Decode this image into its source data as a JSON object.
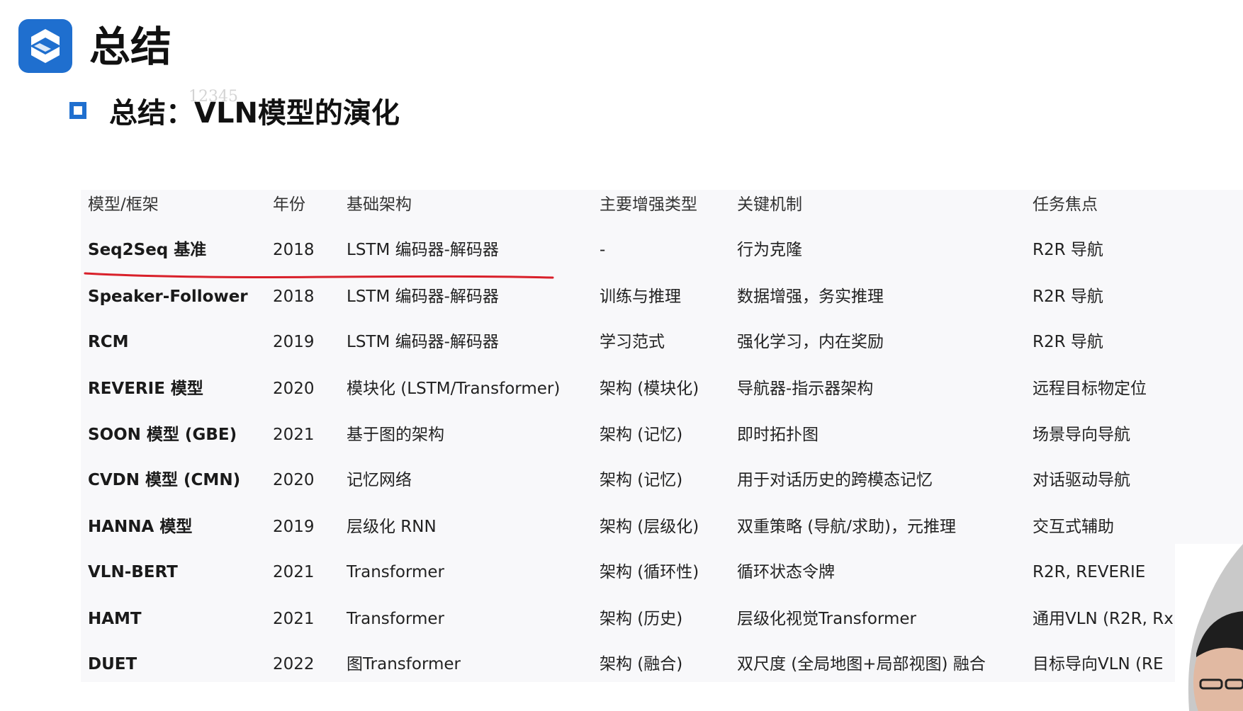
{
  "header": {
    "title": "总结"
  },
  "watermark": "12345",
  "section": {
    "title": "总结：VLN模型的演化"
  },
  "colors": {
    "accent": "#1f6fcf",
    "annotation": "#d9202a",
    "table_bg": "#f8f8fa"
  },
  "icons": {
    "logo": "s-logo-icon",
    "bullet": "square-outline-icon"
  },
  "table": {
    "headers": [
      "模型/框架",
      "年份",
      "基础架构",
      "主要增强类型",
      "关键机制",
      "任务焦点"
    ],
    "rows": [
      [
        "Seq2Seq 基准",
        "2018",
        "LSTM 编码器-解码器",
        "-",
        "行为克隆",
        "R2R 导航"
      ],
      [
        "Speaker-Follower",
        "2018",
        "LSTM 编码器-解码器",
        "训练与推理",
        "数据增强，务实推理",
        "R2R 导航"
      ],
      [
        "RCM",
        "2019",
        "LSTM 编码器-解码器",
        "学习范式",
        "强化学习，内在奖励",
        "R2R 导航"
      ],
      [
        "REVERIE 模型",
        "2020",
        "模块化 (LSTM/Transformer)",
        "架构 (模块化)",
        "导航器-指示器架构",
        "远程目标物定位"
      ],
      [
        "SOON 模型 (GBE)",
        "2021",
        "基于图的架构",
        "架构 (记忆)",
        "即时拓扑图",
        "场景导向导航"
      ],
      [
        "CVDN 模型 (CMN)",
        "2020",
        "记忆网络",
        "架构 (记忆)",
        "用于对话历史的跨模态记忆",
        "对话驱动导航"
      ],
      [
        "HANNA 模型",
        "2019",
        "层级化 RNN",
        "架构 (层级化)",
        "双重策略 (导航/求助)，元推理",
        "交互式辅助"
      ],
      [
        "VLN-BERT",
        "2021",
        "Transformer",
        "架构 (循环性)",
        "循环状态令牌",
        "R2R, REVERIE"
      ],
      [
        "HAMT",
        "2021",
        "Transformer",
        "架构 (历史)",
        "层级化视觉Transformer",
        "通用VLN (R2R, Rx"
      ],
      [
        "DUET",
        "2022",
        "图Transformer",
        "架构 (融合)",
        "双尺度 (全局地图+局部视图) 融合",
        "目标导向VLN (RE"
      ]
    ]
  }
}
